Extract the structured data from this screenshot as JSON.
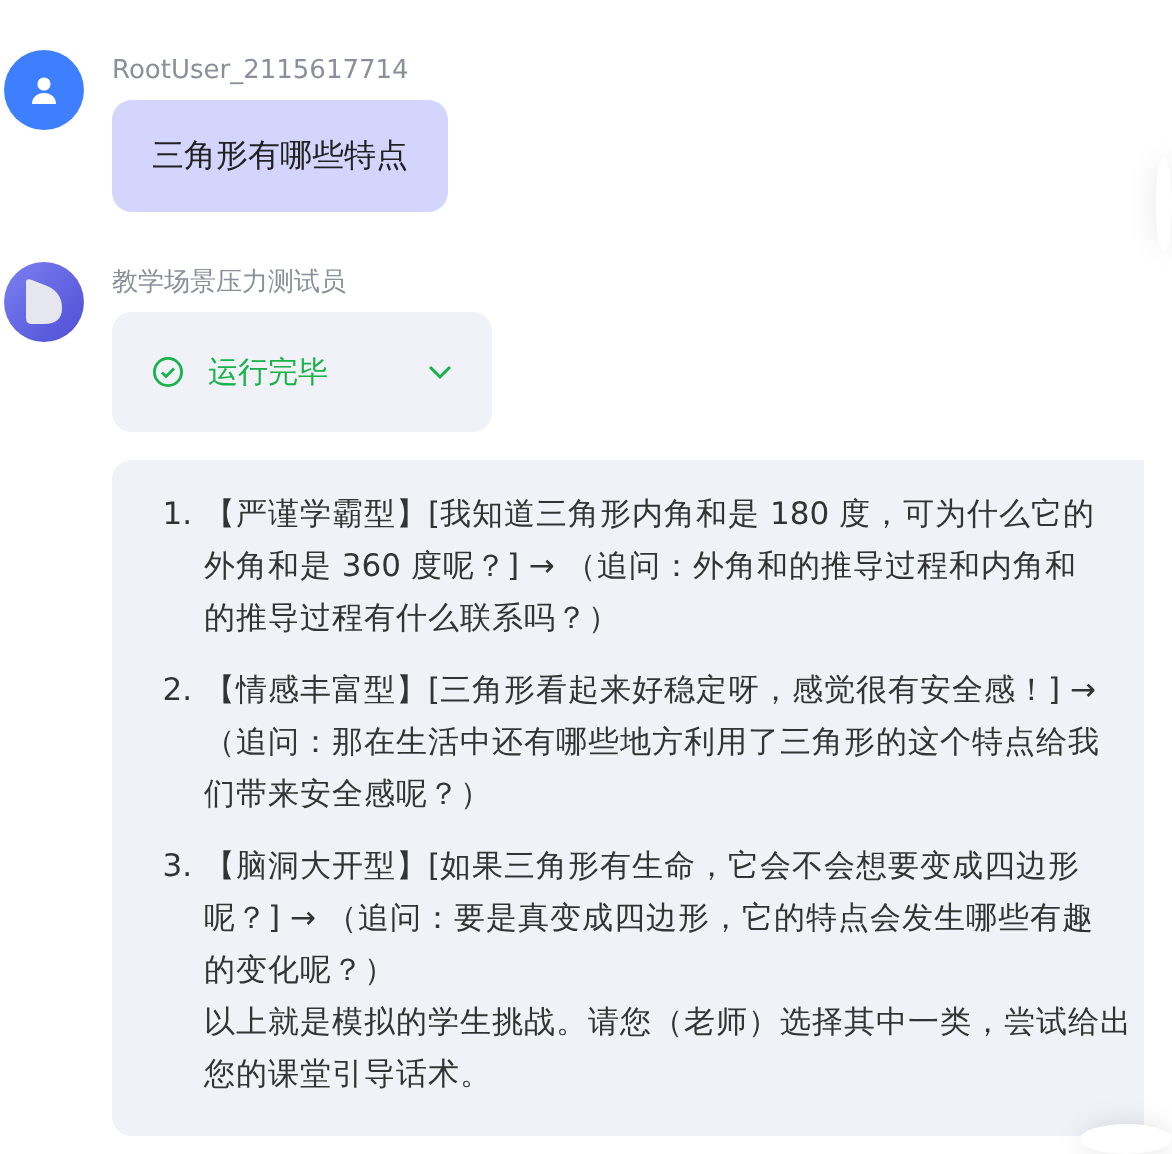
{
  "messages": [
    {
      "kind": "user",
      "author": "RootUser_2115617714",
      "text": "三角形有哪些特点"
    },
    {
      "kind": "bot",
      "author": "教学场景压力测试员",
      "status": {
        "label": "运行完毕",
        "done": true,
        "expanded": false
      },
      "answer": {
        "items": [
          {
            "number": "1.",
            "text": "【严谨学霸型】[我知道三角形内角和是 180 度，可为什么它的外角和是 360 度呢？] → （追问：外角和的推导过程和内角和的推导过程有什么联系吗？）"
          },
          {
            "number": "2.",
            "text": "【情感丰富型】[三角形看起来好稳定呀，感觉很有安全感！] → （追问：那在生活中还有哪些地方利用了三角形的这个特点给我们带来安全感呢？）"
          },
          {
            "number": "3.",
            "text": "【脑洞大开型】[如果三角形有生命，它会不会想要变成四边形呢？] → （追问：要是真变成四边形，它的特点会发生哪些有趣的变化呢？）"
          }
        ],
        "closing": "以上就是模拟的学生挑战。请您（老师）选择其中一类，尝试给出您的课堂引导话术。"
      }
    }
  ]
}
